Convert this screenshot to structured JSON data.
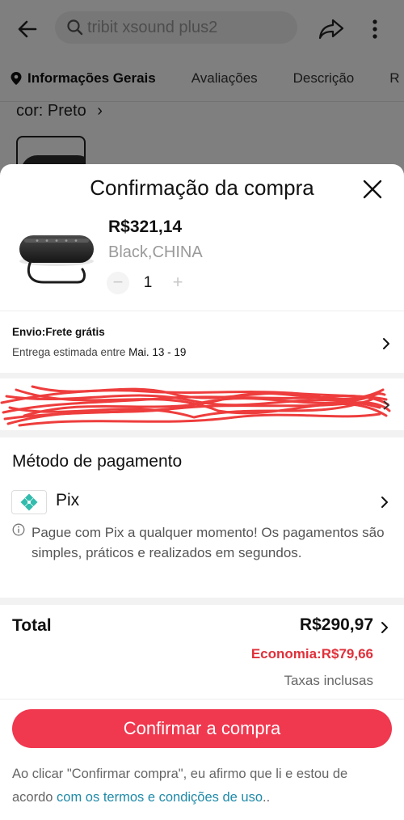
{
  "header": {
    "search_placeholder": "tribit xsound plus2"
  },
  "tabs": [
    {
      "label": "Informações Gerais"
    },
    {
      "label": "Avaliações"
    },
    {
      "label": "Descrição"
    },
    {
      "label": "R"
    }
  ],
  "product_page": {
    "color_label": "cor: Preto",
    "chevron": "›"
  },
  "sheet": {
    "title": "Confirmação da compra",
    "product": {
      "price": "R$321,14",
      "variant": "Black,CHINA",
      "quantity": "1",
      "minus": "−",
      "plus": "+"
    },
    "shipping": {
      "title": "Envio:Frete grátis",
      "estimate_prefix": "Entrega estimada entre ",
      "estimate_dates": "Mai. 13 - 19"
    },
    "payment": {
      "section_title": "Método de pagamento",
      "method": "Pix",
      "note": "Pague com Pix a qualquer momento! Os pagamentos são simples, práticos e realizados em segundos."
    },
    "total": {
      "label": "Total",
      "value": "R$290,97",
      "savings": "Economia:R$79,66",
      "taxes": "Taxas inclusas"
    },
    "confirm_button": "Confirmar a compra",
    "legal": {
      "text": "Ao clicar \"Confirmar compra\", eu afirmo que li e estou de acordo ",
      "link": "com os termos e condições de uso",
      "suffix": ".."
    }
  },
  "colors": {
    "accent": "#f0384f",
    "savings": "#e0303a",
    "link": "#1f8aa8",
    "pix": "#32bcad"
  },
  "icons": [
    "back-arrow-icon",
    "search-icon",
    "share-icon",
    "more-vertical-icon",
    "location-pin-icon",
    "close-icon",
    "chevron-right-icon",
    "pix-icon",
    "info-icon"
  ]
}
